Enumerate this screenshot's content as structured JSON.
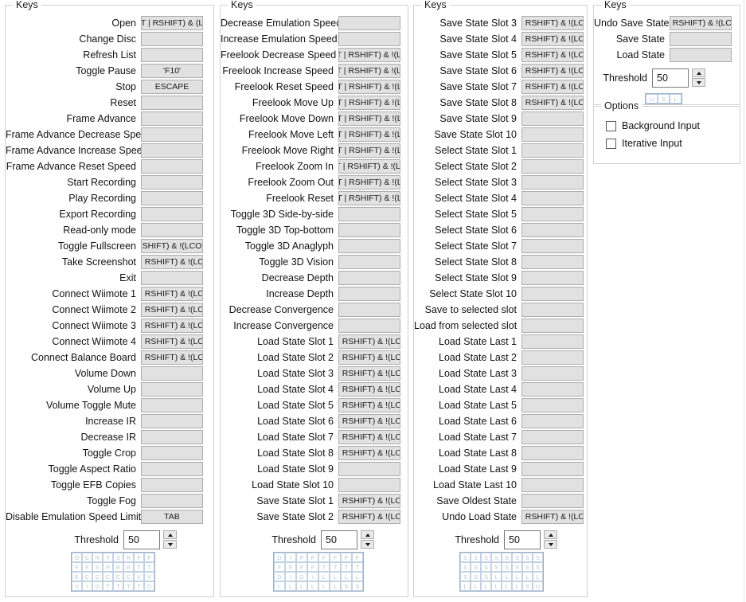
{
  "window": {
    "group_title": "Keys",
    "options_title": "Options"
  },
  "shared": {
    "threshold_label": "Threshold",
    "threshold_value": "50",
    "spin_up_icon": "triangle-up-icon",
    "spin_down_icon": "triangle-down-icon"
  },
  "columns": [
    {
      "id": "column-1",
      "title": "Keys",
      "label_width": 170,
      "btn_width": 78,
      "rows": [
        {
          "label": "Open",
          "value": "'T | RSHIFT) & (L'"
        },
        {
          "label": "Change Disc",
          "value": ""
        },
        {
          "label": "Refresh List",
          "value": ""
        },
        {
          "label": "Toggle Pause",
          "value": "'F10'"
        },
        {
          "label": "Stop",
          "value": "ESCAPE"
        },
        {
          "label": "Reset",
          "value": ""
        },
        {
          "label": "Frame Advance",
          "value": ""
        },
        {
          "label": "Frame Advance Decrease Speed",
          "value": ""
        },
        {
          "label": "Frame Advance Increase Speed",
          "value": ""
        },
        {
          "label": "Frame Advance Reset Speed",
          "value": ""
        },
        {
          "label": "Start Recording",
          "value": ""
        },
        {
          "label": "Play Recording",
          "value": ""
        },
        {
          "label": "Export Recording",
          "value": ""
        },
        {
          "label": "Read-only mode",
          "value": ""
        },
        {
          "label": "Toggle Fullscreen",
          "value": "RSHIFT) & !(LCON"
        },
        {
          "label": "Take Screenshot",
          "value": "| RSHIFT) & !(LC"
        },
        {
          "label": "Exit",
          "value": ""
        },
        {
          "label": "Connect Wiimote 1",
          "value": "| RSHIFT) & !(LC"
        },
        {
          "label": "Connect Wiimote 2",
          "value": "| RSHIFT) & !(LC"
        },
        {
          "label": "Connect Wiimote 3",
          "value": "| RSHIFT) & !(LC"
        },
        {
          "label": "Connect Wiimote 4",
          "value": "| RSHIFT) & !(LC"
        },
        {
          "label": "Connect Balance Board",
          "value": "| RSHIFT) & !(LC"
        },
        {
          "label": "Volume Down",
          "value": ""
        },
        {
          "label": "Volume Up",
          "value": ""
        },
        {
          "label": "Volume Toggle Mute",
          "value": ""
        },
        {
          "label": "Increase IR",
          "value": ""
        },
        {
          "label": "Decrease IR",
          "value": ""
        },
        {
          "label": "Toggle Crop",
          "value": ""
        },
        {
          "label": "Toggle Aspect Ratio",
          "value": ""
        },
        {
          "label": "Toggle EFB Copies",
          "value": ""
        },
        {
          "label": "Toggle Fog",
          "value": ""
        },
        {
          "label": "Disable Emulation Speed Limit",
          "value": "TAB"
        }
      ],
      "grid": {
        "cols": 8,
        "rows": [
          [
            "O",
            "C",
            "R",
            "T",
            "S",
            "R",
            "F",
            "F"
          ],
          [
            "F",
            "F",
            "S",
            "P",
            "E",
            "R",
            "T",
            "T"
          ],
          [
            "E",
            "C",
            "C",
            "C",
            "C",
            "C",
            "V",
            "V"
          ],
          [
            "V",
            "I",
            "D",
            "T",
            "T",
            "T",
            "T",
            "D"
          ]
        ]
      }
    },
    {
      "id": "column-2",
      "title": "Keys",
      "label_width": 148,
      "btn_width": 78,
      "rows": [
        {
          "label": "Decrease Emulation Speed",
          "value": ""
        },
        {
          "label": "Increase Emulation Speed",
          "value": ""
        },
        {
          "label": "Freelook Decrease Speed",
          "value": "'T | RSHIFT) & !(L("
        },
        {
          "label": "Freelook Increase Speed",
          "value": "'T | RSHIFT) & !(L("
        },
        {
          "label": "Freelook Reset Speed",
          "value": "T | RSHIFT) & !(L"
        },
        {
          "label": "Freelook Move Up",
          "value": "T | RSHIFT) & !(L"
        },
        {
          "label": "Freelook Move Down",
          "value": "T | RSHIFT) & !(L"
        },
        {
          "label": "Freelook Move Left",
          "value": "T | RSHIFT) & !(L"
        },
        {
          "label": "Freelook Move Right",
          "value": "T | RSHIFT) & !(L"
        },
        {
          "label": "Freelook Zoom In",
          "value": "T | RSHIFT) & !(L("
        },
        {
          "label": "Freelook Zoom Out",
          "value": "T | RSHIFT) & !(L"
        },
        {
          "label": "Freelook Reset",
          "value": "T | RSHIFT) & !(L"
        },
        {
          "label": "Toggle 3D Side-by-side",
          "value": ""
        },
        {
          "label": "Toggle 3D Top-bottom",
          "value": ""
        },
        {
          "label": "Toggle 3D Anaglyph",
          "value": ""
        },
        {
          "label": "Toggle 3D Vision",
          "value": ""
        },
        {
          "label": "Decrease Depth",
          "value": ""
        },
        {
          "label": "Increase Depth",
          "value": ""
        },
        {
          "label": "Decrease Convergence",
          "value": ""
        },
        {
          "label": "Increase Convergence",
          "value": ""
        },
        {
          "label": "Load State Slot 1",
          "value": "| RSHIFT) & !(LC"
        },
        {
          "label": "Load State Slot 2",
          "value": "| RSHIFT) & !(LC"
        },
        {
          "label": "Load State Slot 3",
          "value": "| RSHIFT) & !(LC"
        },
        {
          "label": "Load State Slot 4",
          "value": "| RSHIFT) & !(LC"
        },
        {
          "label": "Load State Slot 5",
          "value": "| RSHIFT) & !(LC"
        },
        {
          "label": "Load State Slot 6",
          "value": "| RSHIFT) & !(LC"
        },
        {
          "label": "Load State Slot 7",
          "value": "| RSHIFT) & !(LC"
        },
        {
          "label": "Load State Slot 8",
          "value": "| RSHIFT) & !(LC"
        },
        {
          "label": "Load State Slot 9",
          "value": ""
        },
        {
          "label": "Load State Slot 10",
          "value": ""
        },
        {
          "label": "Save State Slot 1",
          "value": "| RSHIFT) & !(LC"
        },
        {
          "label": "Save State Slot 2",
          "value": "| RSHIFT) & !(LC"
        }
      ],
      "grid": {
        "cols": 8,
        "rows": [
          [
            "D",
            "I",
            "F",
            "F",
            "F",
            "F",
            "F",
            "F"
          ],
          [
            "F",
            "F",
            "F",
            "F",
            "T",
            "T",
            "T",
            "T"
          ],
          [
            "D",
            "I",
            "D",
            "I",
            "L",
            "L",
            "L",
            "L"
          ],
          [
            "L",
            "L",
            "L",
            "L",
            "L",
            "L",
            "S",
            "S"
          ]
        ]
      }
    },
    {
      "id": "column-3",
      "title": "Keys",
      "label_width": 135,
      "btn_width": 78,
      "rows": [
        {
          "label": "Save State Slot 3",
          "value": "| RSHIFT) & !(LC"
        },
        {
          "label": "Save State Slot 4",
          "value": "| RSHIFT) & !(LC"
        },
        {
          "label": "Save State Slot 5",
          "value": "| RSHIFT) & !(LC"
        },
        {
          "label": "Save State Slot 6",
          "value": "| RSHIFT) & !(LC"
        },
        {
          "label": "Save State Slot 7",
          "value": "| RSHIFT) & !(LC"
        },
        {
          "label": "Save State Slot 8",
          "value": "| RSHIFT) & !(LC"
        },
        {
          "label": "Save State Slot 9",
          "value": ""
        },
        {
          "label": "Save State Slot 10",
          "value": ""
        },
        {
          "label": "Select State Slot 1",
          "value": ""
        },
        {
          "label": "Select State Slot 2",
          "value": ""
        },
        {
          "label": "Select State Slot 3",
          "value": ""
        },
        {
          "label": "Select State Slot 4",
          "value": ""
        },
        {
          "label": "Select State Slot 5",
          "value": ""
        },
        {
          "label": "Select State Slot 6",
          "value": ""
        },
        {
          "label": "Select State Slot 7",
          "value": ""
        },
        {
          "label": "Select State Slot 8",
          "value": ""
        },
        {
          "label": "Select State Slot 9",
          "value": ""
        },
        {
          "label": "Select State Slot 10",
          "value": ""
        },
        {
          "label": "Save to selected slot",
          "value": ""
        },
        {
          "label": "Load from selected slot",
          "value": ""
        },
        {
          "label": "Load State Last 1",
          "value": ""
        },
        {
          "label": "Load State Last 2",
          "value": ""
        },
        {
          "label": "Load State Last 3",
          "value": ""
        },
        {
          "label": "Load State Last 4",
          "value": ""
        },
        {
          "label": "Load State Last 5",
          "value": ""
        },
        {
          "label": "Load State Last 6",
          "value": ""
        },
        {
          "label": "Load State Last 7",
          "value": ""
        },
        {
          "label": "Load State Last 8",
          "value": ""
        },
        {
          "label": "Load State Last 9",
          "value": ""
        },
        {
          "label": "Load State Last 10",
          "value": ""
        },
        {
          "label": "Save Oldest State",
          "value": ""
        },
        {
          "label": "Undo Load State",
          "value": "| RSHIFT) & !(LC"
        }
      ],
      "grid": {
        "cols": 8,
        "rows": [
          [
            "S",
            "S",
            "S",
            "S",
            "S",
            "S",
            "S",
            "S"
          ],
          [
            "S",
            "S",
            "S",
            "S",
            "S",
            "S",
            "S",
            "S"
          ],
          [
            "S",
            "S",
            "S",
            "L",
            "L",
            "L",
            "L",
            "L"
          ],
          [
            "L",
            "L",
            "L",
            "L",
            "L",
            "L",
            "S",
            "U"
          ]
        ]
      }
    },
    {
      "id": "column-4",
      "title": "Keys",
      "label_width": 95,
      "btn_width": 78,
      "rows": [
        {
          "label": "Undo Save State",
          "value": "| RSHIFT) & !(LC'"
        },
        {
          "label": "Save State",
          "value": ""
        },
        {
          "label": "Load State",
          "value": ""
        }
      ],
      "grid": {
        "cols": 3,
        "rows": [
          [
            "U",
            "S",
            "L"
          ]
        ]
      }
    }
  ],
  "options": {
    "title": "Options",
    "items": [
      {
        "label": "Background Input",
        "checked": false
      },
      {
        "label": "Iterative Input",
        "checked": false
      }
    ]
  }
}
